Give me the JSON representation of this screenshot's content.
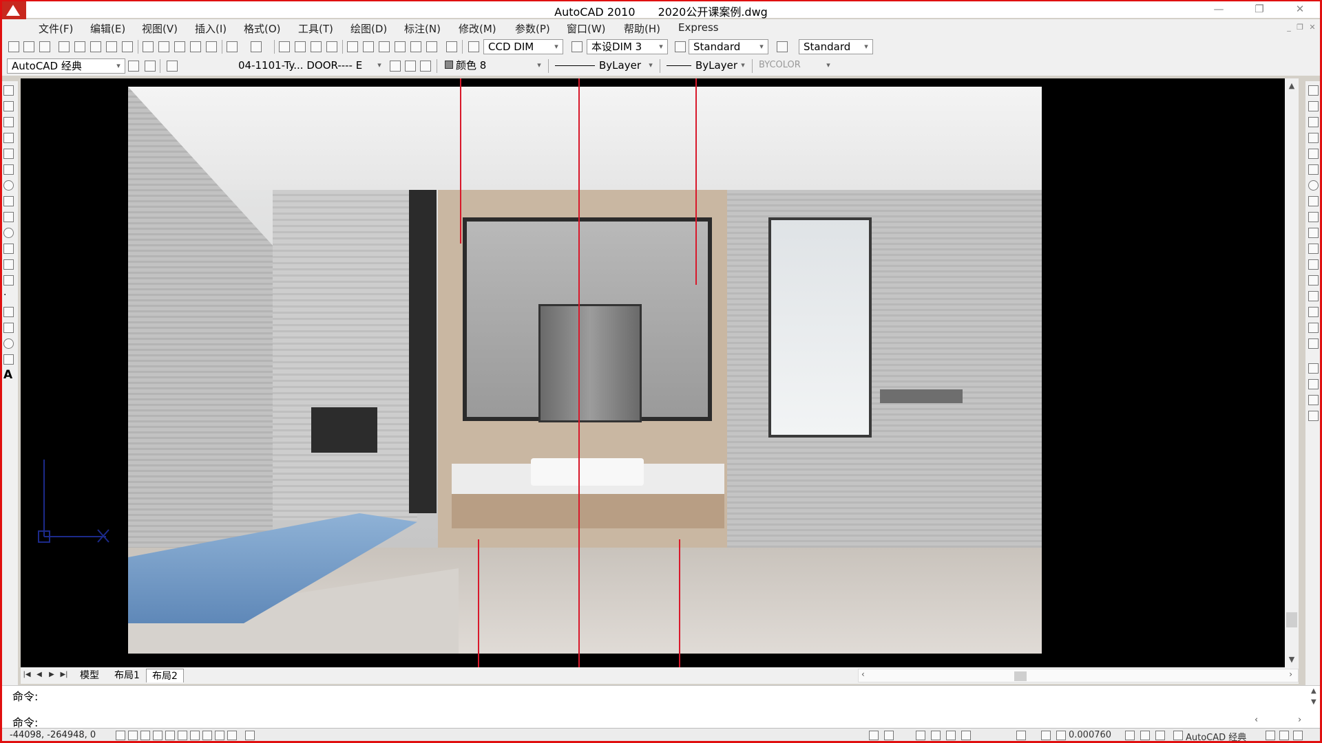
{
  "title": {
    "app_name": "AutoCAD 2010",
    "file_name": "2020公开课案例.dwg",
    "minimize": "—",
    "maximize": "❐",
    "close": "✕"
  },
  "menu": [
    "文件(F)",
    "编辑(E)",
    "视图(V)",
    "插入(I)",
    "格式(O)",
    "工具(T)",
    "绘图(D)",
    "标注(N)",
    "修改(M)",
    "参数(P)",
    "窗口(W)",
    "帮助(H)",
    "Express"
  ],
  "toolbar1": {
    "text_style": "CCD DIM",
    "dim_style": "本设DIM 3",
    "table_style": "Standard",
    "multileader_style": "Standard"
  },
  "toolbar2": {
    "workspace": "AutoCAD 经典",
    "layer": "04-1101-Ty... DOOR---- E",
    "color": "颜色 8",
    "linetype": "ByLayer",
    "lineweight": "ByLayer",
    "plotstyle": "BYCOLOR"
  },
  "layout_tabs": {
    "model": "模型",
    "layout1": "布局1",
    "layout2": "布局2",
    "active": "布局2"
  },
  "command": {
    "history_line": "命令:",
    "prompt_line": "命令:"
  },
  "status": {
    "coordinates": "-44098, -264948, 0",
    "annotation_scale": "0.000760",
    "workspace_label": "AutoCAD 经典"
  },
  "icons": {
    "left_toolbar": [
      "line-icon",
      "construction-line-icon",
      "polyline-icon",
      "polygon-icon",
      "rectangle-icon",
      "arc-icon",
      "circle-icon",
      "revision-cloud-icon",
      "spline-icon",
      "ellipse-icon",
      "ellipse-arc-icon",
      "insert-block-icon",
      "make-block-icon",
      "point-icon",
      "hatch-icon",
      "gradient-icon",
      "region-icon",
      "table-icon",
      "multiline-text-icon"
    ],
    "right_toolbar": [
      "erase-icon",
      "copy-icon",
      "mirror-icon",
      "offset-icon",
      "array-icon",
      "move-icon",
      "rotate-icon",
      "scale-icon",
      "stretch-icon",
      "trim-icon",
      "extend-icon",
      "break-at-point-icon",
      "break-icon",
      "join-icon",
      "chamfer-icon",
      "fillet-icon",
      "explode-icon"
    ]
  },
  "colors": {
    "accent_red": "#e01010",
    "guide_line_red": "#d8182a",
    "canvas_bg": "#000000"
  }
}
